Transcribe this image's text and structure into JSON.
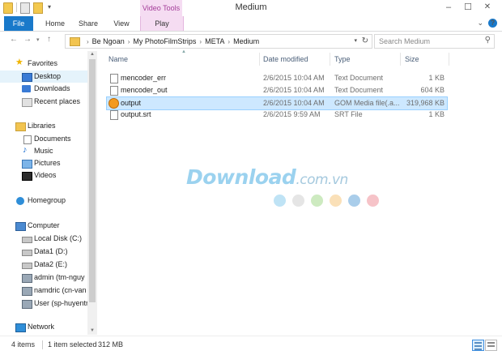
{
  "window": {
    "title": "Medium",
    "context_group": "Video Tools",
    "controls": [
      "–",
      "☐",
      "✕"
    ]
  },
  "ribbon": {
    "tabs": {
      "file": "File",
      "home": "Home",
      "share": "Share",
      "view": "View",
      "play": "Play"
    },
    "expand": "⌄"
  },
  "address": {
    "breadcrumbs": [
      "Be Ngoan",
      "My PhotoFilmStrips",
      "META",
      "Medium"
    ],
    "search_placeholder": "Search Medium"
  },
  "sidebar": {
    "favorites": "Favorites",
    "desktop": "Desktop",
    "downloads": "Downloads",
    "recent": "Recent places",
    "libraries": "Libraries",
    "documents": "Documents",
    "music": "Music",
    "pictures": "Pictures",
    "videos": "Videos",
    "homegroup": "Homegroup",
    "computer": "Computer",
    "local_disk": "Local Disk (C:)",
    "data1": "Data1 (D:)",
    "data2": "Data2 (E:)",
    "admin": "admin (tm-nguy",
    "namdric": "namdric (cn-van",
    "user": "User (sp-huyentr",
    "network": "Network"
  },
  "columns": {
    "name": "Name",
    "date": "Date modified",
    "type": "Type",
    "size": "Size"
  },
  "files": [
    {
      "name": "mencoder_err",
      "date": "2/6/2015 10:04 AM",
      "type": "Text Document",
      "size": "1 KB"
    },
    {
      "name": "mencoder_out",
      "date": "2/6/2015 10:04 AM",
      "type": "Text Document",
      "size": "604 KB"
    },
    {
      "name": "output",
      "date": "2/6/2015 10:04 AM",
      "type": "GOM Media file(.a...",
      "size": "319,968 KB"
    },
    {
      "name": "output.srt",
      "date": "2/6/2015 9:59 AM",
      "type": "SRT File",
      "size": "1 KB"
    }
  ],
  "watermark": {
    "main": "Download",
    "suffix": ".com.vn",
    "dot_colors": [
      "#bfe3f5",
      "#e5e5e5",
      "#cdeac0",
      "#fae0b8",
      "#a9cdea",
      "#f6c3c8"
    ]
  },
  "status": {
    "items": "4 items",
    "selected": "1 item selected",
    "size": "312 MB"
  },
  "colors": {
    "accent": "#1979ca",
    "context_tab": "#f5dcf2",
    "selection": "#cde8ff"
  }
}
